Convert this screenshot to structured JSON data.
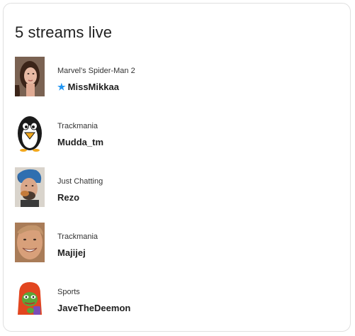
{
  "header": {
    "title": "5 streams live"
  },
  "streams": [
    {
      "game": "Marvel's Spider-Man 2",
      "name": "MissMikkaa",
      "favorite": true,
      "avatar_icon": "woman-portrait"
    },
    {
      "game": "Trackmania",
      "name": "Mudda_tm",
      "favorite": false,
      "avatar_icon": "penguin-cartoon"
    },
    {
      "game": "Just Chatting",
      "name": "Rezo",
      "favorite": false,
      "avatar_icon": "blue-haired-man-portrait"
    },
    {
      "game": "Trackmania",
      "name": "Majijej",
      "favorite": false,
      "avatar_icon": "smiling-face-portrait"
    },
    {
      "game": "Sports",
      "name": "JaveTheDeemon",
      "favorite": false,
      "avatar_icon": "pepe-frog-hoodie"
    }
  ],
  "favorite_icon": "star-icon",
  "colors": {
    "favorite_star": "#2196f3",
    "card_border": "#e0e0e0",
    "text": "#212121"
  }
}
